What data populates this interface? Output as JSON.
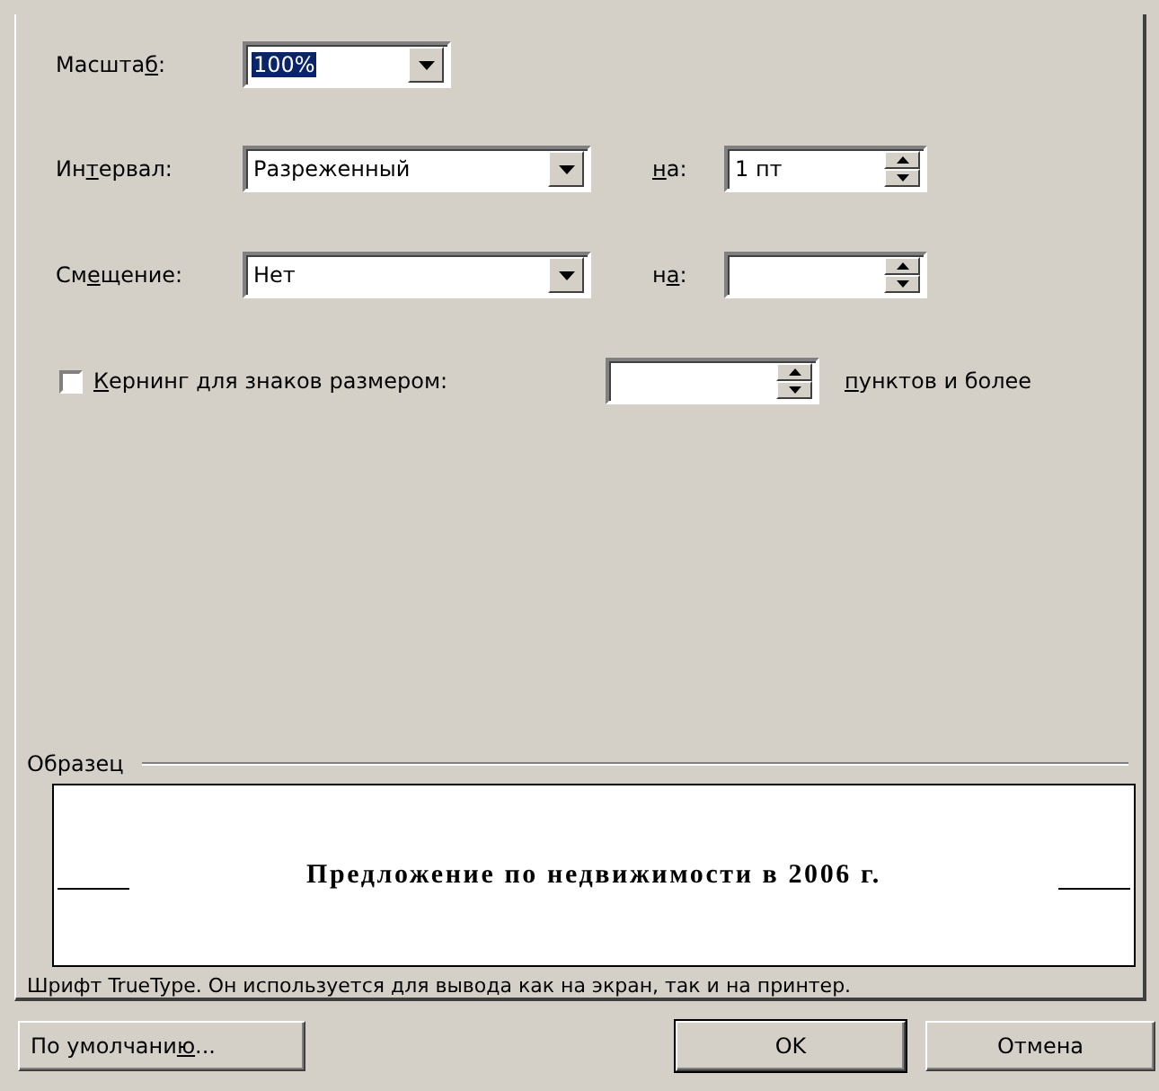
{
  "scale": {
    "label": {
      "before": "Масшта",
      "key": "б",
      "after": ":"
    },
    "value": "100%",
    "selected_text": true
  },
  "spacing": {
    "label": {
      "before": "Ин",
      "key": "т",
      "after": "ервал:"
    },
    "value": "Разреженный",
    "by_label": {
      "key": "н",
      "after": "а:"
    },
    "by_value": "1 пт"
  },
  "position": {
    "label": {
      "before": "См",
      "key": "е",
      "after": "щение:"
    },
    "value": "Нет",
    "by_label": {
      "before": "н",
      "key": "а",
      "after": ":"
    }
  },
  "kerning": {
    "label": {
      "key": "К",
      "after": "ернинг для знаков размером:"
    },
    "checked": false,
    "suffix": {
      "key": "п",
      "after": "унктов и более"
    }
  },
  "preview": {
    "title": "Образец",
    "text": "Предложение по недвижимости в 2006 г."
  },
  "note": "Шрифт TrueType. Он используется для вывода как на экран, так и на принтер.",
  "buttons": [
    {
      "label": {
        "before": "По умолчани",
        "key": "ю",
        "after": "..."
      },
      "kind": "plain"
    },
    {
      "label": {
        "before": "OK"
      },
      "kind": "default"
    },
    {
      "label": {
        "before": "Отмена"
      },
      "kind": "plain"
    }
  ]
}
